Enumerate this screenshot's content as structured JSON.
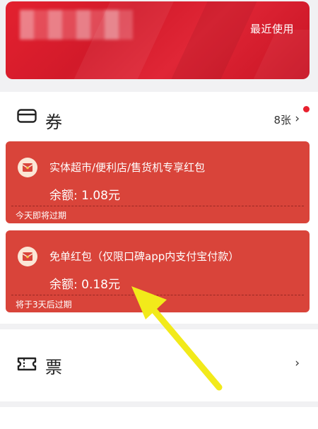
{
  "header": {
    "recent_label": "最近使用",
    "brand_color": "#e3212f"
  },
  "coupons": {
    "section_title": "券",
    "count": "8张",
    "chevron": "›",
    "items": [
      {
        "title": "实体超市/便利店/售货机专享红包",
        "balance": "余额: 1.08元",
        "expire": "今天即将过期"
      },
      {
        "title": "免单红包（仅限口碑app内支付宝付款）",
        "balance": "余额: 0.18元",
        "expire": "将于3天后过期"
      }
    ]
  },
  "tickets": {
    "section_title": "票",
    "chevron": "›"
  },
  "colors": {
    "packet_bg": "#d9443a",
    "arrow": "#f2ea1a",
    "badge": "#e8212e"
  },
  "icons": {
    "coupon": "coupon-icon",
    "red_packet": "red-packet-icon",
    "ticket": "ticket-icon",
    "chevron": "chevron-right-icon",
    "annotation": "arrow-annotation"
  }
}
